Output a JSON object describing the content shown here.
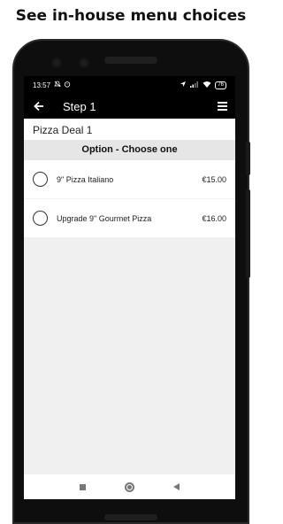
{
  "headline": "See in-house menu choices",
  "status_bar": {
    "time": "13:57",
    "left_icons": [
      "notification-muted-icon",
      "alarm-icon"
    ],
    "right_icons": [
      "location-icon",
      "signal-icon",
      "wifi-icon"
    ],
    "battery": "76"
  },
  "app_bar": {
    "back_icon": "arrow-left-icon",
    "title": "Step 1",
    "menu_icon": "hamburger-menu-icon"
  },
  "deal_title": "Pizza Deal 1",
  "section_header": "Option - Choose one",
  "options": [
    {
      "name": "9\" Pizza Italiano",
      "price": "€15.00",
      "selected": false
    },
    {
      "name": "Upgrade 9\" Gourmet Pizza",
      "price": "€16.00",
      "selected": false
    }
  ],
  "nav_bar": {
    "icons": [
      "recents-square-icon",
      "home-circle-icon",
      "back-triangle-icon"
    ]
  },
  "colors": {
    "app_bar": "#000000",
    "screen_background": "#f0f0f0",
    "section_header_background": "#e6e6e6"
  }
}
